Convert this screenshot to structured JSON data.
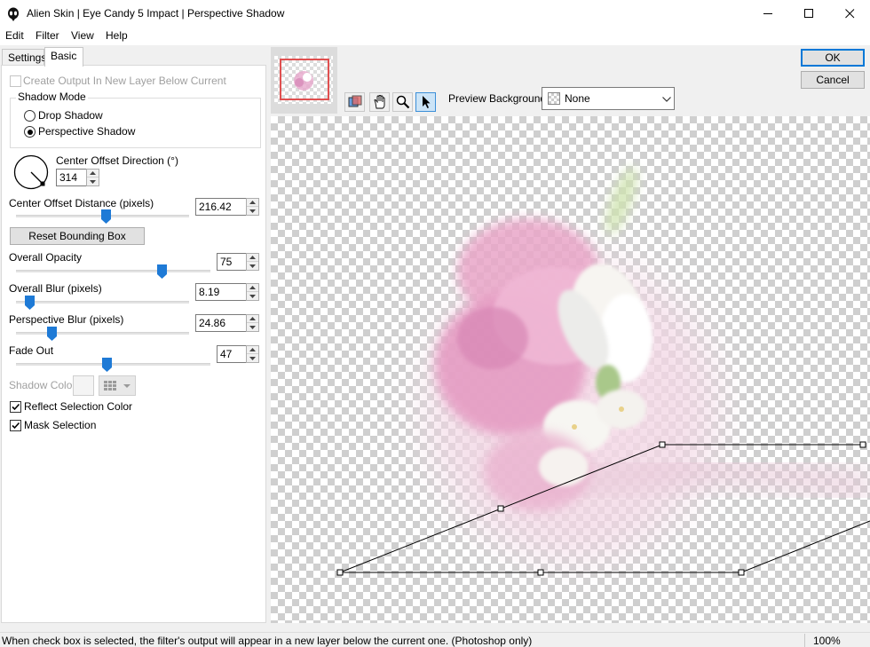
{
  "window": {
    "title": "Alien Skin | Eye Candy 5 Impact | Perspective Shadow",
    "minimize_icon": "minimize-icon",
    "maximize_icon": "maximize-icon",
    "close_icon": "close-icon"
  },
  "menu": [
    "Edit",
    "Filter",
    "View",
    "Help"
  ],
  "tabs": [
    "Settings",
    "Basic"
  ],
  "active_tab": "Basic",
  "basic": {
    "create_output_label": "Create Output In New Layer Below Current",
    "create_output_checked": false,
    "shadow_mode_label": "Shadow Mode",
    "drop_shadow_label": "Drop Shadow",
    "perspective_shadow_label": "Perspective Shadow",
    "shadow_mode_selected": "Perspective Shadow",
    "direction_label": "Center Offset Direction (°)",
    "direction_value": "314",
    "offset_distance_label": "Center Offset Distance (pixels)",
    "offset_distance_value": "216.42",
    "offset_distance_slider": 0.52,
    "reset_button": "Reset Bounding Box",
    "opacity_label": "Overall Opacity",
    "opacity_value": "75",
    "opacity_slider": 0.75,
    "blur_label": "Overall Blur (pixels)",
    "blur_value": "8.19",
    "blur_slider": 0.08,
    "persp_blur_label": "Perspective Blur (pixels)",
    "persp_blur_value": "24.86",
    "persp_blur_slider": 0.21,
    "fade_label": "Fade Out",
    "fade_value": "47",
    "fade_slider": 0.47,
    "shadow_color_label": "Shadow Color",
    "reflect_label": "Reflect Selection Color",
    "reflect_checked": true,
    "mask_label": "Mask Selection",
    "mask_checked": true
  },
  "preview": {
    "background_label": "Preview Background:",
    "background_value": "None",
    "tools": [
      "preview-toggle-icon",
      "hand-icon",
      "zoom-icon",
      "arrow-pointer-icon"
    ]
  },
  "buttons": {
    "ok": "OK",
    "cancel": "Cancel"
  },
  "status": {
    "message": "When check box is selected, the filter's output will appear in a new layer below the current one. (Photoshop only)",
    "zoom": "100%"
  },
  "colors": {
    "accent": "#0078d7",
    "thumb_blue": "#1e7ad6"
  }
}
